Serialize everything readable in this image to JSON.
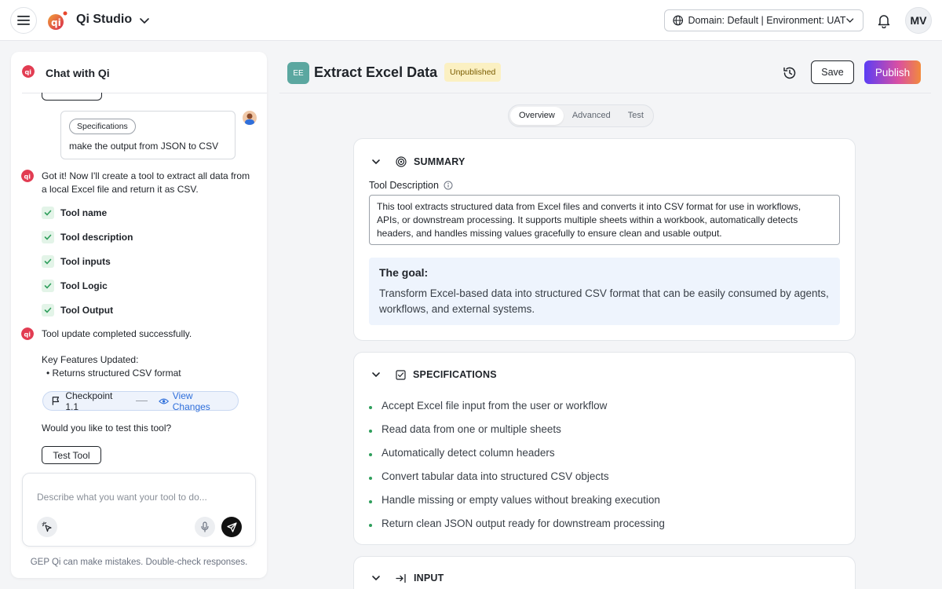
{
  "app": {
    "title": "Qi Studio",
    "environment": "Domain: Default | Environment: UAT",
    "user_initials": "MV"
  },
  "chat": {
    "title": "Chat with Qi",
    "user_message": {
      "chip": "Specifications",
      "text": "make the output from JSON to CSV"
    },
    "bot_reply_line1": "Got it! Now I'll create a tool to extract all data from",
    "bot_reply_line2": "a local Excel file and return it as CSV.",
    "checklist": [
      "Tool name",
      "Tool description",
      "Tool inputs",
      "Tool Logic",
      "Tool Output"
    ],
    "update_message": "Tool update completed successfully.",
    "key_features_title": "Key Features Updated:",
    "key_feature_item": "•  Returns structured CSV format",
    "checkpoint_label": "Checkpoint 1.1",
    "view_changes_label": "View Changes",
    "test_question": "Would you like to test this tool?",
    "test_button": "Test Tool",
    "composer_placeholder": "Describe what you want your tool to do...",
    "disclaimer": "GEP Qi can make mistakes. Double-check responses."
  },
  "tool": {
    "badge": "EE",
    "title": "Extract Excel Data",
    "status": "Unpublished",
    "save_label": "Save",
    "publish_label": "Publish"
  },
  "tabs": [
    "Overview",
    "Advanced",
    "Test"
  ],
  "summary": {
    "heading": "SUMMARY",
    "field_label": "Tool Description",
    "description_lines": [
      "This tool extracts structured data from Excel files and converts it into CSV format for use in workflows,",
      "APIs, or downstream processing. It supports multiple sheets within a workbook, automatically detects",
      "headers, and handles missing values gracefully to ensure clean and usable output."
    ],
    "goal_title": "The goal:",
    "goal_lines": [
      "Transform Excel-based data into structured CSV format that can be easily consumed by agents,",
      "workflows, and external systems."
    ]
  },
  "specifications": {
    "heading": "SPECIFICATIONS",
    "items": [
      "Accept Excel file input from the user or workflow",
      "Read data from one or multiple sheets",
      "Automatically detect column headers",
      "Convert tabular data into structured CSV objects",
      "Handle missing or empty values without breaking execution",
      "Return clean JSON output ready for downstream processing"
    ]
  },
  "input": {
    "heading": "INPUT"
  },
  "colors": {
    "accent_blue": "#2f6fdb",
    "check_green": "#2e9e5b",
    "badge_teal": "#5ba7a0",
    "status_yellow": "#fbf0c2",
    "goal_bg": "#eef4fd"
  },
  "icons": {
    "menu": "hamburger-icon",
    "app_switch": "chevron-down-icon",
    "globe": "globe-icon",
    "notifications": "bell-icon",
    "history": "history-icon",
    "section_toggle": "chevron-down-icon",
    "summary": "target-icon",
    "specifications": "checkbox-icon",
    "input": "input-arrow-icon",
    "checkpoint": "flag-icon",
    "view": "eye-icon",
    "magic": "magic-cursor-icon",
    "mic": "microphone-icon",
    "send": "send-icon"
  }
}
